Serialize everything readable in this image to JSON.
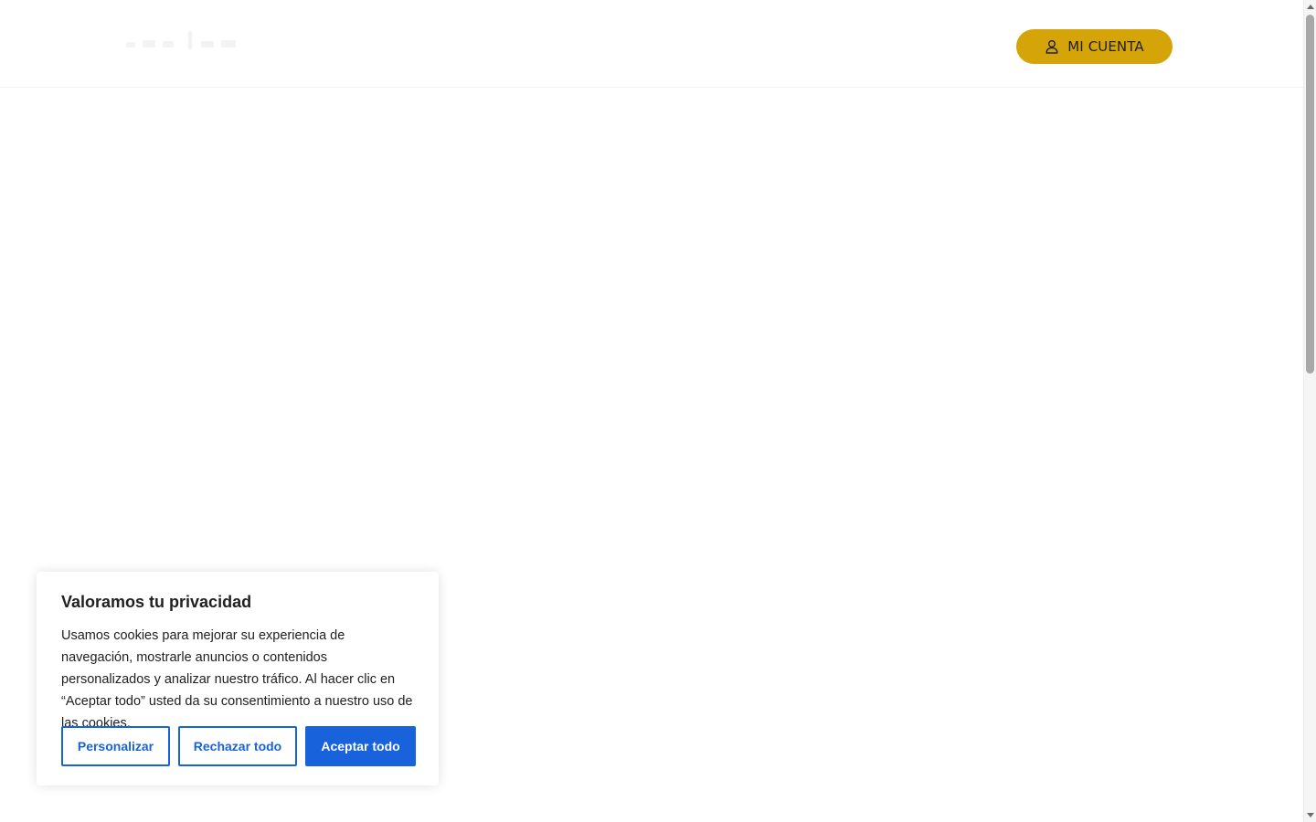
{
  "header": {
    "account_button_label": "MI CUENTA",
    "account_button_color": "#d4a408",
    "account_icon": "user-icon"
  },
  "cookie_banner": {
    "title": "Valoramos tu privacidad",
    "body": "Usamos cookies para mejorar su experiencia de navegación, mostrarle anuncios o contenidos personalizados y analizar nuestro tráfico. Al hacer clic en “Aceptar todo” usted da su consentimiento a nuestro uso de las cookies.",
    "buttons": {
      "customize": "Personalizar",
      "reject_all": "Rechazar todo",
      "accept_all": "Aceptar todo"
    },
    "accent_color": "#1863dc"
  }
}
